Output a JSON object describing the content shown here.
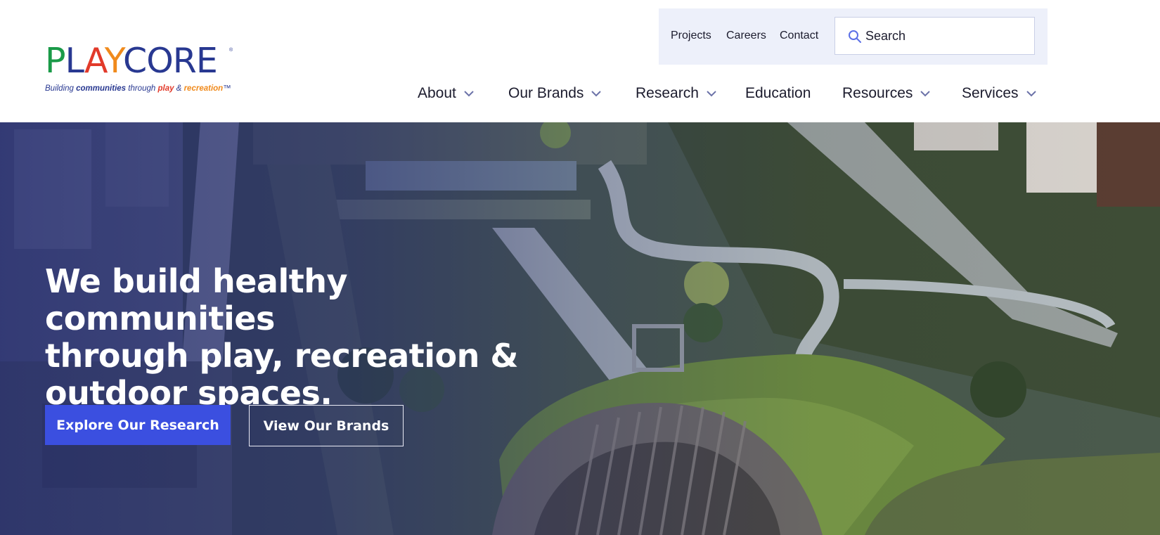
{
  "logo": {
    "letters": [
      {
        "char": "P",
        "color": "#1a9a48"
      },
      {
        "char": "L",
        "color": "#283891"
      },
      {
        "char": "A",
        "color": "#e23a2a"
      },
      {
        "char": "Y",
        "color": "#f08a1c"
      },
      {
        "char": "C",
        "color": "#283891"
      },
      {
        "char": "O",
        "color": "#283891"
      },
      {
        "char": "R",
        "color": "#283891"
      },
      {
        "char": "E",
        "color": "#283891"
      }
    ],
    "trademark": "®",
    "tagline_parts": {
      "building": "Building",
      "communities": "communities",
      "through": "through",
      "play": "play",
      "amp": "&",
      "recreation": "recreation",
      "tm": "™"
    }
  },
  "utility_nav": {
    "links": [
      "Projects",
      "Careers",
      "Contact"
    ],
    "search_placeholder": "Search"
  },
  "main_nav": [
    {
      "label": "About",
      "has_dropdown": true
    },
    {
      "label": "Our Brands",
      "has_dropdown": true
    },
    {
      "label": "Research",
      "has_dropdown": true
    },
    {
      "label": "Education",
      "has_dropdown": false
    },
    {
      "label": "Resources",
      "has_dropdown": true
    },
    {
      "label": "Services",
      "has_dropdown": true
    }
  ],
  "hero": {
    "headline_regular_1": "We build ",
    "headline_bold": "healthy communities",
    "headline_regular_2": "through play, recreation & outdoor spaces.",
    "primary_button": "Explore Our Research",
    "secondary_button": "View Our Brands"
  },
  "colors": {
    "brand_blue": "#283891",
    "button_blue": "#3b4fe0",
    "utility_bg": "#edf0fa"
  }
}
